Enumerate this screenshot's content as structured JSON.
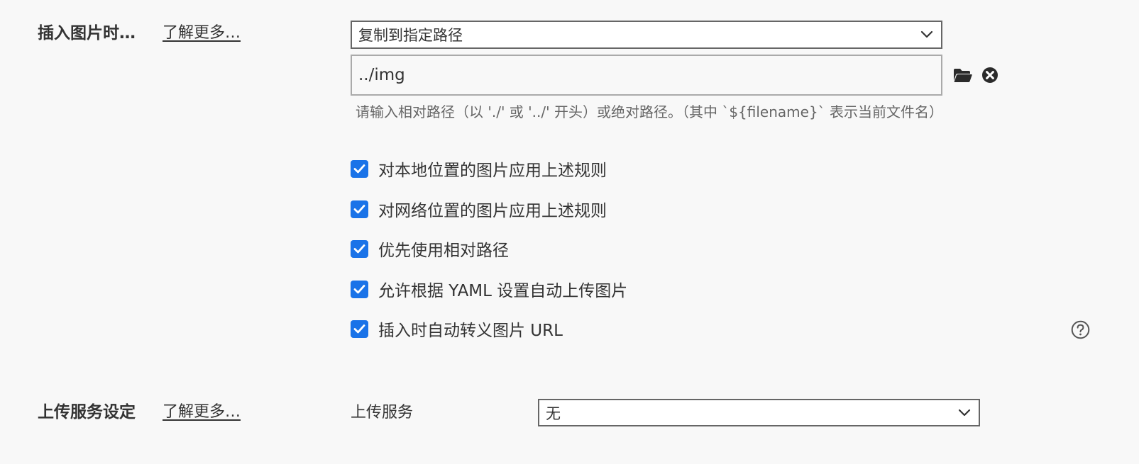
{
  "image_insert": {
    "title": "插入图片时…",
    "learn_more": "了解更多…",
    "action_select": "复制到指定路径",
    "path_value": "../img",
    "path_hint": "请输入相对路径（以 './' 或 '../' 开头）或绝对路径。（其中 `${filename}` 表示当前文件名）",
    "options": [
      {
        "label": "对本地位置的图片应用上述规则",
        "checked": true
      },
      {
        "label": "对网络位置的图片应用上述规则",
        "checked": true
      },
      {
        "label": "优先使用相对路径",
        "checked": true
      },
      {
        "label": "允许根据 YAML 设置自动上传图片",
        "checked": true
      },
      {
        "label": "插入时自动转义图片 URL",
        "checked": true
      }
    ],
    "icons": {
      "browse": "folder-icon",
      "clear": "close-circle-icon",
      "help": "help-icon"
    }
  },
  "upload_service": {
    "title": "上传服务设定",
    "learn_more": "了解更多…",
    "field_label": "上传服务",
    "service_select": "无"
  },
  "colors": {
    "accent": "#1a73e8",
    "background": "#f8f8f8",
    "text": "#333333",
    "hint_text": "#666666"
  }
}
